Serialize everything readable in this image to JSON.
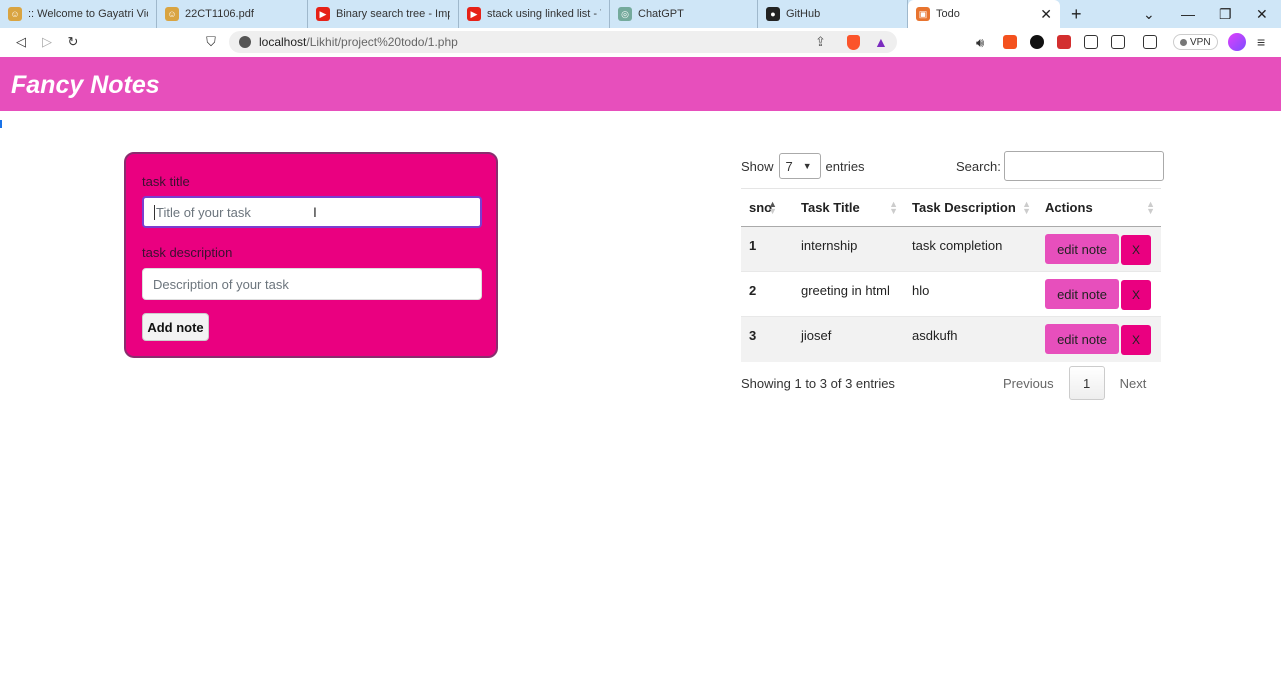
{
  "browser": {
    "tabs": [
      {
        "title": ":: Welcome to Gayatri Vidya",
        "fav_color": "#d9a441",
        "fav_glyph": "☺"
      },
      {
        "title": "22CT1106.pdf",
        "fav_color": "#d9a441",
        "fav_glyph": "☺"
      },
      {
        "title": "Binary search tree - Implem",
        "fav_color": "#e62117",
        "fav_glyph": "▶"
      },
      {
        "title": "stack using linked list - You",
        "fav_color": "#e62117",
        "fav_glyph": "▶"
      },
      {
        "title": "ChatGPT",
        "fav_color": "#74aa9c",
        "fav_glyph": "◎"
      },
      {
        "title": "GitHub",
        "fav_color": "#222222",
        "fav_glyph": "●"
      },
      {
        "title": "Todo",
        "fav_color": "#e8742f",
        "fav_glyph": "▣"
      }
    ],
    "active_tab_close": "✕",
    "new_tab": "+",
    "url_host": "localhost",
    "url_path": "/Likhit/project%20todo/1.php",
    "vpn_label": "VPN"
  },
  "header": {
    "brand": "Fancy Notes"
  },
  "form": {
    "title_label": "task title",
    "title_placeholder": "Title of your task",
    "desc_label": "task description",
    "desc_placeholder": "Description of your task",
    "submit_label": "Add note"
  },
  "table": {
    "show_label": "Show",
    "entries_label": "entries",
    "page_length": "7",
    "search_label": "Search:",
    "columns": [
      "sno",
      "Task Title",
      "Task Description",
      "Actions"
    ],
    "rows": [
      {
        "sno": "1",
        "title": "internship",
        "description": "task completion",
        "edit": "edit note",
        "delete": "X"
      },
      {
        "sno": "2",
        "title": "greeting in html",
        "description": "hlo",
        "edit": "edit note",
        "delete": "X"
      },
      {
        "sno": "3",
        "title": "jiosef",
        "description": "asdkufh",
        "edit": "edit note",
        "delete": "X"
      }
    ],
    "info": "Showing 1 to 3 of 3 entries",
    "prev_label": "Previous",
    "current_page": "1",
    "next_label": "Next"
  }
}
